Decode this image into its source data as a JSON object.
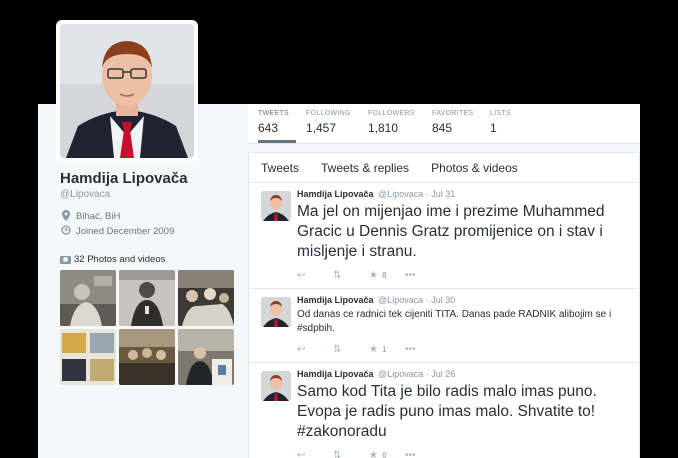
{
  "profile": {
    "name": "Hamdija Lipovača",
    "handle": "@Lipovaca",
    "location": "Bihać, BiH",
    "joined": "Joined December 2009",
    "photos_label": "32 Photos and videos"
  },
  "stats": [
    {
      "label": "TWEETS",
      "value": "643"
    },
    {
      "label": "FOLLOWING",
      "value": "1,457"
    },
    {
      "label": "FOLLOWERS",
      "value": "1,810"
    },
    {
      "label": "FAVORITES",
      "value": "845"
    },
    {
      "label": "LISTS",
      "value": "1"
    }
  ],
  "tabs": [
    "Tweets",
    "Tweets & replies",
    "Photos & videos"
  ],
  "tweets": [
    {
      "name": "Hamdija Lipovača",
      "handle": "@Lipovaca",
      "sep": "·",
      "date": "Jul 31",
      "text": "Ma jel on mijenjao ime i prezime Muhammed Gracic u Dennis Gratz promijenice on i stav i misljenje i stranu.",
      "favorites": "8"
    },
    {
      "name": "Hamdija Lipovača",
      "handle": "@Lipovaca",
      "sep": "·",
      "date": "Jul 30",
      "text": "Od danas ce radnici tek cijeniti TITA. Danas pade RADNIK alibojim se i #sdpbih.",
      "favorites": "1"
    },
    {
      "name": "Hamdija Lipovača",
      "handle": "@Lipovaca",
      "sep": "·",
      "date": "Jul 26",
      "text": "Samo kod Tita je bilo radis malo imas puno. Evopa je radis puno imas malo. Shvatite to! #zakonoradu",
      "favorites": "6"
    }
  ],
  "icons": {
    "location": "map-pin-icon",
    "joined": "calendar-icon",
    "photos": "camera-icon",
    "reply": "reply-icon",
    "retweet": "retweet-icon",
    "favorite": "star-icon",
    "more": "more-icon"
  },
  "colors": {
    "text": "#292f33",
    "muted": "#8899a6",
    "border": "#e1e8ed",
    "background": "#f5f8fa",
    "tie": "#c8102e"
  }
}
